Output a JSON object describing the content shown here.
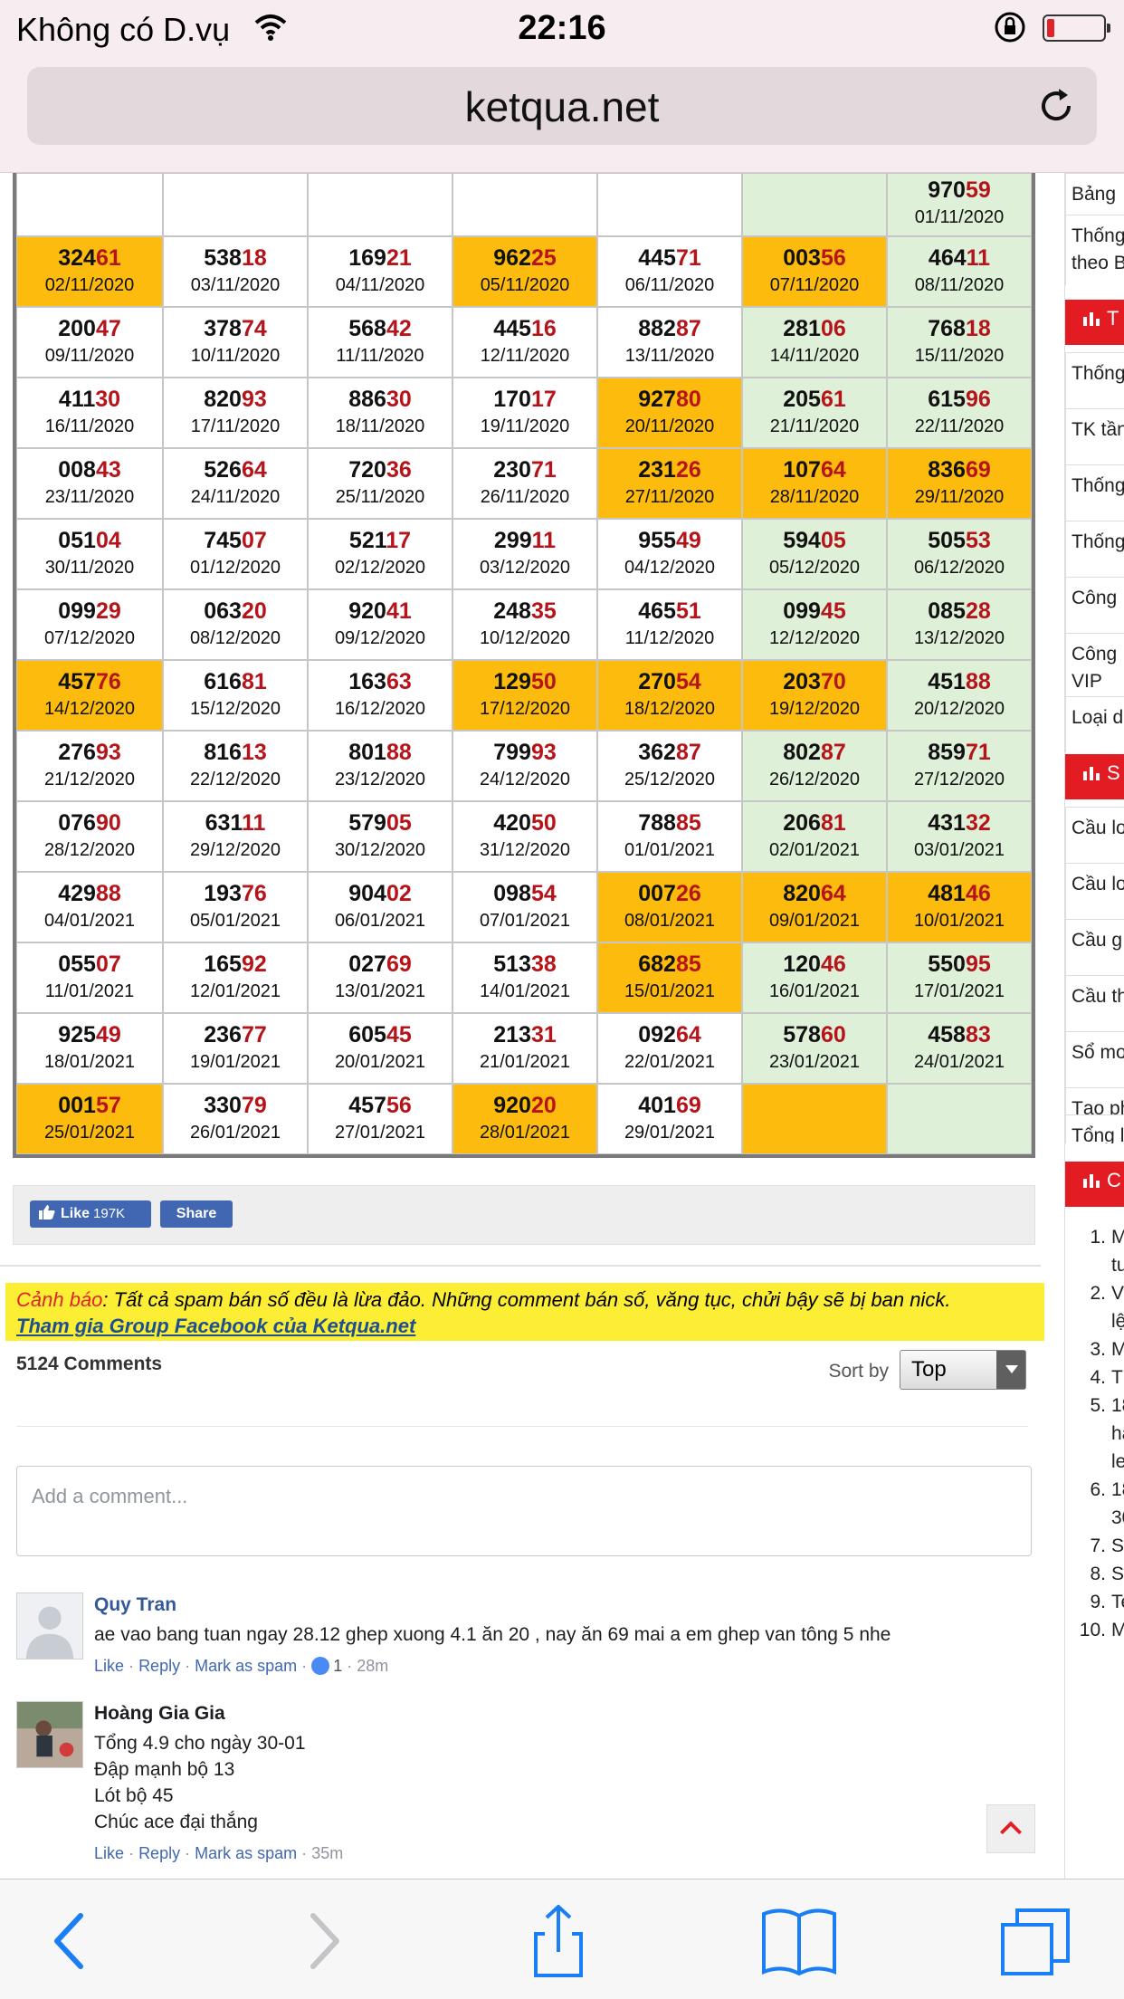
{
  "status_bar": {
    "carrier": "Không có D.vụ",
    "time": "22:16"
  },
  "browser": {
    "url": "ketqua.net"
  },
  "colors": {
    "highlight": "#fdbb0d",
    "sunday": "#dff0d9",
    "accent_red": "#b5141a",
    "sidebar_red": "#e31b23",
    "warning_bg": "#fcee34"
  },
  "results": {
    "rows": [
      [
        {
          "n": "",
          "d": "",
          "hl": false
        },
        {
          "n": "",
          "d": "",
          "hl": false
        },
        {
          "n": "",
          "d": "",
          "hl": false
        },
        {
          "n": "",
          "d": "",
          "hl": false
        },
        {
          "n": "",
          "d": "",
          "hl": false
        },
        {
          "n": "",
          "d": "",
          "hl": false
        },
        {
          "n": "97059",
          "d": "01/11/2020",
          "hl": false
        }
      ],
      [
        {
          "n": "32461",
          "d": "02/11/2020",
          "hl": true
        },
        {
          "n": "53818",
          "d": "03/11/2020",
          "hl": false
        },
        {
          "n": "16921",
          "d": "04/11/2020",
          "hl": false
        },
        {
          "n": "96225",
          "d": "05/11/2020",
          "hl": true
        },
        {
          "n": "44571",
          "d": "06/11/2020",
          "hl": false
        },
        {
          "n": "00356",
          "d": "07/11/2020",
          "hl": true
        },
        {
          "n": "46411",
          "d": "08/11/2020",
          "hl": false
        }
      ],
      [
        {
          "n": "20047",
          "d": "09/11/2020",
          "hl": false
        },
        {
          "n": "37874",
          "d": "10/11/2020",
          "hl": false
        },
        {
          "n": "56842",
          "d": "11/11/2020",
          "hl": false
        },
        {
          "n": "44516",
          "d": "12/11/2020",
          "hl": false
        },
        {
          "n": "88287",
          "d": "13/11/2020",
          "hl": false
        },
        {
          "n": "28106",
          "d": "14/11/2020",
          "hl": false
        },
        {
          "n": "76818",
          "d": "15/11/2020",
          "hl": false
        }
      ],
      [
        {
          "n": "41130",
          "d": "16/11/2020",
          "hl": false
        },
        {
          "n": "82093",
          "d": "17/11/2020",
          "hl": false
        },
        {
          "n": "88630",
          "d": "18/11/2020",
          "hl": false
        },
        {
          "n": "17017",
          "d": "19/11/2020",
          "hl": false
        },
        {
          "n": "92780",
          "d": "20/11/2020",
          "hl": true
        },
        {
          "n": "20561",
          "d": "21/11/2020",
          "hl": false
        },
        {
          "n": "61596",
          "d": "22/11/2020",
          "hl": false
        }
      ],
      [
        {
          "n": "00843",
          "d": "23/11/2020",
          "hl": false
        },
        {
          "n": "52664",
          "d": "24/11/2020",
          "hl": false
        },
        {
          "n": "72036",
          "d": "25/11/2020",
          "hl": false
        },
        {
          "n": "23071",
          "d": "26/11/2020",
          "hl": false
        },
        {
          "n": "23126",
          "d": "27/11/2020",
          "hl": true
        },
        {
          "n": "10764",
          "d": "28/11/2020",
          "hl": true
        },
        {
          "n": "83669",
          "d": "29/11/2020",
          "hl": true
        }
      ],
      [
        {
          "n": "05104",
          "d": "30/11/2020",
          "hl": false
        },
        {
          "n": "74507",
          "d": "01/12/2020",
          "hl": false
        },
        {
          "n": "52117",
          "d": "02/12/2020",
          "hl": false
        },
        {
          "n": "29911",
          "d": "03/12/2020",
          "hl": false
        },
        {
          "n": "95549",
          "d": "04/12/2020",
          "hl": false
        },
        {
          "n": "59405",
          "d": "05/12/2020",
          "hl": false
        },
        {
          "n": "50553",
          "d": "06/12/2020",
          "hl": false
        }
      ],
      [
        {
          "n": "09929",
          "d": "07/12/2020",
          "hl": false
        },
        {
          "n": "06320",
          "d": "08/12/2020",
          "hl": false
        },
        {
          "n": "92041",
          "d": "09/12/2020",
          "hl": false
        },
        {
          "n": "24835",
          "d": "10/12/2020",
          "hl": false
        },
        {
          "n": "46551",
          "d": "11/12/2020",
          "hl": false
        },
        {
          "n": "09945",
          "d": "12/12/2020",
          "hl": false
        },
        {
          "n": "08528",
          "d": "13/12/2020",
          "hl": false
        }
      ],
      [
        {
          "n": "45776",
          "d": "14/12/2020",
          "hl": true
        },
        {
          "n": "61681",
          "d": "15/12/2020",
          "hl": false
        },
        {
          "n": "16363",
          "d": "16/12/2020",
          "hl": false
        },
        {
          "n": "12950",
          "d": "17/12/2020",
          "hl": true
        },
        {
          "n": "27054",
          "d": "18/12/2020",
          "hl": true
        },
        {
          "n": "20370",
          "d": "19/12/2020",
          "hl": true
        },
        {
          "n": "45188",
          "d": "20/12/2020",
          "hl": false
        }
      ],
      [
        {
          "n": "27693",
          "d": "21/12/2020",
          "hl": false
        },
        {
          "n": "81613",
          "d": "22/12/2020",
          "hl": false
        },
        {
          "n": "80188",
          "d": "23/12/2020",
          "hl": false
        },
        {
          "n": "79993",
          "d": "24/12/2020",
          "hl": false
        },
        {
          "n": "36287",
          "d": "25/12/2020",
          "hl": false
        },
        {
          "n": "80287",
          "d": "26/12/2020",
          "hl": false
        },
        {
          "n": "85971",
          "d": "27/12/2020",
          "hl": false
        }
      ],
      [
        {
          "n": "07690",
          "d": "28/12/2020",
          "hl": false
        },
        {
          "n": "63111",
          "d": "29/12/2020",
          "hl": false
        },
        {
          "n": "57905",
          "d": "30/12/2020",
          "hl": false
        },
        {
          "n": "42050",
          "d": "31/12/2020",
          "hl": false
        },
        {
          "n": "78885",
          "d": "01/01/2021",
          "hl": false
        },
        {
          "n": "20681",
          "d": "02/01/2021",
          "hl": false
        },
        {
          "n": "43132",
          "d": "03/01/2021",
          "hl": false
        }
      ],
      [
        {
          "n": "42988",
          "d": "04/01/2021",
          "hl": false
        },
        {
          "n": "19376",
          "d": "05/01/2021",
          "hl": false
        },
        {
          "n": "90402",
          "d": "06/01/2021",
          "hl": false
        },
        {
          "n": "09854",
          "d": "07/01/2021",
          "hl": false
        },
        {
          "n": "00726",
          "d": "08/01/2021",
          "hl": true
        },
        {
          "n": "82064",
          "d": "09/01/2021",
          "hl": true
        },
        {
          "n": "48146",
          "d": "10/01/2021",
          "hl": true
        }
      ],
      [
        {
          "n": "05507",
          "d": "11/01/2021",
          "hl": false
        },
        {
          "n": "16592",
          "d": "12/01/2021",
          "hl": false
        },
        {
          "n": "02769",
          "d": "13/01/2021",
          "hl": false
        },
        {
          "n": "51338",
          "d": "14/01/2021",
          "hl": false
        },
        {
          "n": "68285",
          "d": "15/01/2021",
          "hl": true
        },
        {
          "n": "12046",
          "d": "16/01/2021",
          "hl": false
        },
        {
          "n": "55095",
          "d": "17/01/2021",
          "hl": false
        }
      ],
      [
        {
          "n": "92549",
          "d": "18/01/2021",
          "hl": false
        },
        {
          "n": "23677",
          "d": "19/01/2021",
          "hl": false
        },
        {
          "n": "60545",
          "d": "20/01/2021",
          "hl": false
        },
        {
          "n": "21331",
          "d": "21/01/2021",
          "hl": false
        },
        {
          "n": "09264",
          "d": "22/01/2021",
          "hl": false
        },
        {
          "n": "57860",
          "d": "23/01/2021",
          "hl": false
        },
        {
          "n": "45883",
          "d": "24/01/2021",
          "hl": false
        }
      ],
      [
        {
          "n": "00157",
          "d": "25/01/2021",
          "hl": true
        },
        {
          "n": "33079",
          "d": "26/01/2021",
          "hl": false
        },
        {
          "n": "45756",
          "d": "27/01/2021",
          "hl": false
        },
        {
          "n": "92020",
          "d": "28/01/2021",
          "hl": true
        },
        {
          "n": "40169",
          "d": "29/01/2021",
          "hl": false
        },
        {
          "n": "",
          "d": "",
          "hl": true
        },
        {
          "n": "",
          "d": "",
          "hl": false
        }
      ]
    ]
  },
  "social": {
    "like_label": "Like",
    "like_count": "197K",
    "share_label": "Share"
  },
  "warning": {
    "label": "Cảnh báo",
    "text": ": Tất cả spam bán số đều là lừa đảo. Những comment bán số, văng tục, chửi bậy sẽ bị ban nick.",
    "link": "Tham gia Group Facebook của Ketqua.net"
  },
  "comments": {
    "count": "5124 Comments",
    "sort_label": "Sort by",
    "sort_value": "Top",
    "placeholder": "Add a comment...",
    "like": "Like",
    "reply": "Reply",
    "spam": "Mark as spam",
    "sep": "·",
    "items": [
      {
        "author": "Quy Tran",
        "lines": [
          "ae vao bang tuan ngay 28.12 ghep xuong 4.1 ăn 20 , nay ăn 69 mai a em ghep van tông 5 nhe"
        ],
        "reactions": "1",
        "time": "28m"
      },
      {
        "author": "Hoàng Gia Gia",
        "lines": [
          "Tổng 4.9 cho ngày 30-01",
          "Đập mạnh bộ 13",
          "Lót bộ 45",
          "Chúc ace đại thắng"
        ],
        "time": "35m"
      }
    ]
  },
  "sidebar": {
    "items": [
      "Bảng",
      "Thống",
      "theo B",
      "Thống",
      "TK tần",
      "Thống",
      "Thống",
      "Công",
      "Công",
      "VIP",
      "Loại d",
      "Cầu lo",
      "Cầu lo",
      "Cầu g",
      "Cầu th",
      "Sổ mo",
      "Tạo ph",
      "Tổng l"
    ],
    "head_1": "T",
    "head_2": "S",
    "head_3": "C",
    "list": [
      {
        "n": "1.",
        "t": "M"
      },
      {
        "n": "",
        "t": "tu"
      },
      {
        "n": "2.",
        "t": "Vr"
      },
      {
        "n": "",
        "t": "lệ"
      },
      {
        "n": "3.",
        "t": "M"
      },
      {
        "n": "4.",
        "t": "Th"
      },
      {
        "n": "5.",
        "t": "18"
      },
      {
        "n": "",
        "t": "ha"
      },
      {
        "n": "",
        "t": "lea"
      },
      {
        "n": "6.",
        "t": "18"
      },
      {
        "n": "",
        "t": "30"
      },
      {
        "n": "7.",
        "t": "So"
      },
      {
        "n": "8.",
        "t": "So"
      },
      {
        "n": "9.",
        "t": "Te"
      },
      {
        "n": "10.",
        "t": "M"
      }
    ]
  },
  "icons": {
    "wifi": "wifi-icon",
    "reload": "reload-icon",
    "back": "back-icon",
    "forward": "forward-icon",
    "share": "share-icon",
    "bookmarks": "bookmarks-icon",
    "tabs": "tabs-icon",
    "scroll_top": "chevron-up-icon"
  }
}
